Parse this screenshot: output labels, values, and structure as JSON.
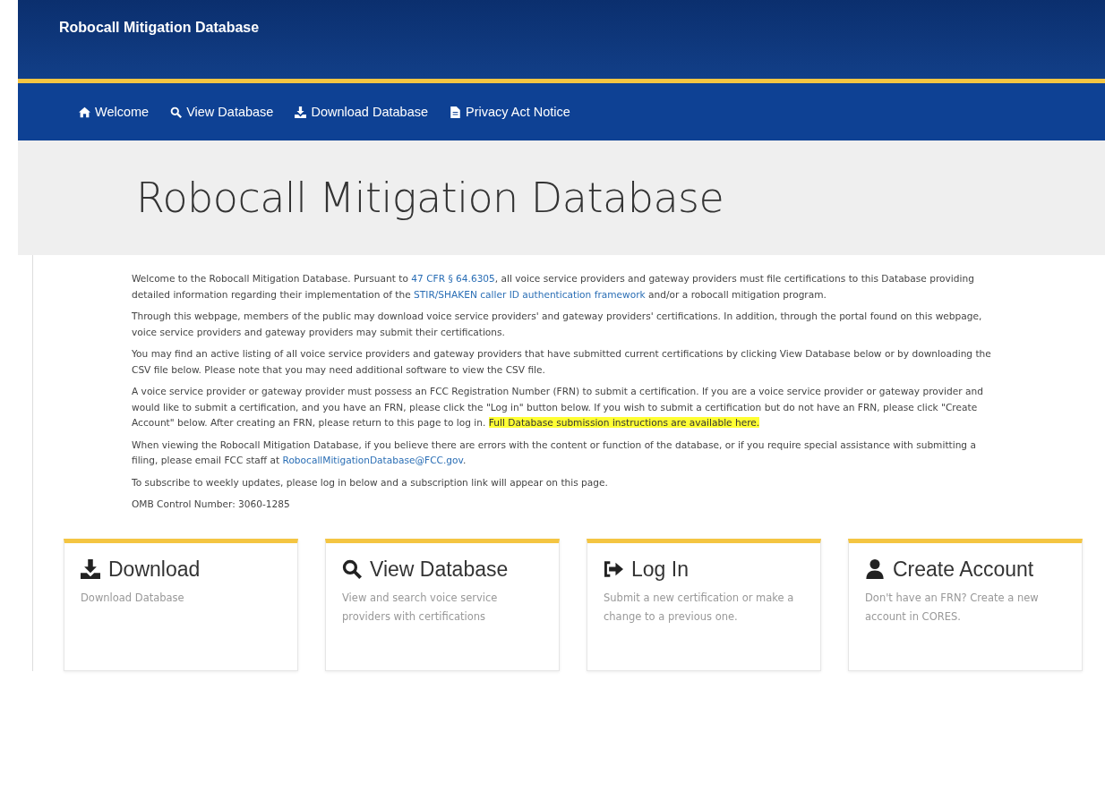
{
  "header": {
    "title": "Robocall Mitigation Database"
  },
  "nav": [
    {
      "label": "Welcome",
      "kind": "home"
    },
    {
      "label": "View Database",
      "kind": "search"
    },
    {
      "label": "Download Database",
      "kind": "download"
    },
    {
      "label": "Privacy Act Notice",
      "kind": "file"
    }
  ],
  "hero": {
    "title": "Robocall Mitigation Database"
  },
  "paragraphs": [
    [
      {
        "kind": "text",
        "text": "Welcome to the Robocall Mitigation Database. Pursuant to "
      },
      {
        "kind": "link",
        "text": "47 CFR § 64.6305"
      },
      {
        "kind": "text",
        "text": ", all voice service providers and gateway providers must file certifications to this Database providing detailed information regarding their implementation of the "
      },
      {
        "kind": "link",
        "text": "STIR/SHAKEN caller ID authentication framework"
      },
      {
        "kind": "text",
        "text": " and/or a robocall mitigation program."
      }
    ],
    [
      {
        "kind": "text",
        "text": "Through this webpage, members of the public may download voice service providers' and gateway providers' certifications. In addition, through the portal found on this webpage, voice service providers and gateway providers may submit their certifications."
      }
    ],
    [
      {
        "kind": "text",
        "text": "You may find an active listing of all voice service providers and gateway providers that have submitted current certifications by clicking View Database below or by downloading the CSV file below. Please note that you may need additional software to view the CSV file."
      }
    ],
    [
      {
        "kind": "text",
        "text": "A voice service provider or gateway provider must possess an FCC Registration Number (FRN) to submit a certification. If you are a voice service provider or gateway provider and would like to submit a certification, and you have an FRN, please click the \"Log in\" button below. If you wish to submit a certification but do not have an FRN, please click \"Create Account\" below. After creating an FRN, please return to this page to log in. "
      },
      {
        "kind": "highlight",
        "text": "Full Database submission instructions are available here."
      }
    ],
    [
      {
        "kind": "text",
        "text": "When viewing the Robocall Mitigation Database, if you believe there are errors with the content or function of the database, or if you require special assistance with submitting a filing, please email FCC staff at "
      },
      {
        "kind": "link",
        "text": "RobocallMitigationDatabase@FCC.gov"
      },
      {
        "kind": "text",
        "text": "."
      }
    ],
    [
      {
        "kind": "text",
        "text": "To subscribe to weekly updates, please log in below and a subscription link will appear on this page."
      }
    ],
    [
      {
        "kind": "text",
        "text": "OMB Control Number: 3060-1285"
      }
    ]
  ],
  "cards": [
    {
      "title": "Download",
      "kind": "download",
      "description": "Download Database"
    },
    {
      "title": "View Database",
      "kind": "search",
      "description": "View and search voice service providers with certifications"
    },
    {
      "title": "Log In",
      "kind": "login",
      "description": "Submit a new certification or make a change to a previous one."
    },
    {
      "title": "Create Account",
      "kind": "user",
      "description": "Don't have an FRN? Create a new account in CORES."
    }
  ]
}
